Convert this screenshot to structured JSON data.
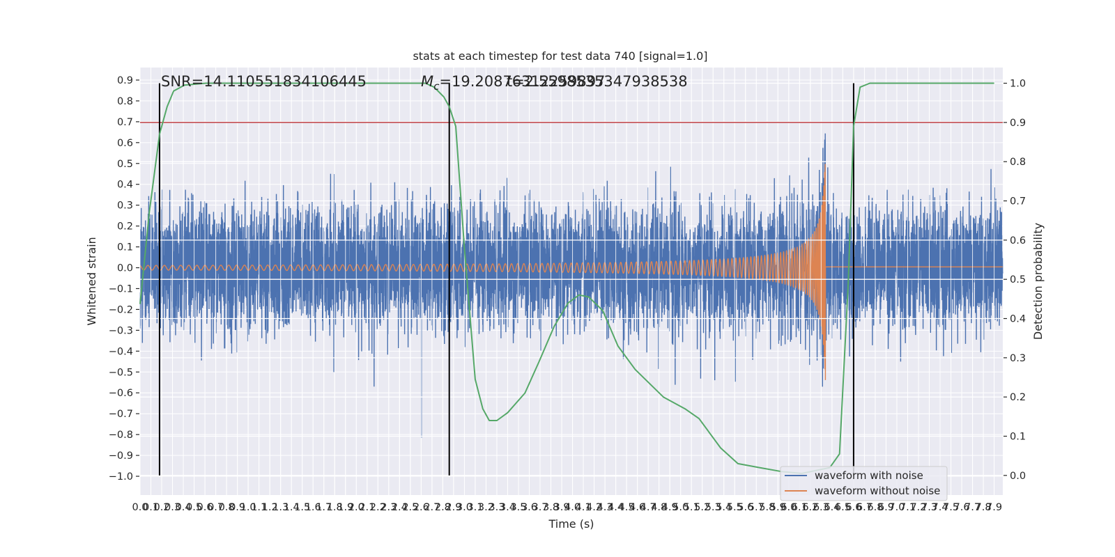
{
  "chart_data": {
    "type": "line",
    "title": "stats at each timestep for test data 740 [signal=1.0]",
    "xlabel": "Time (s)",
    "ylabel": "Whitened strain",
    "ylabel_right": "Detection probability",
    "xlim": [
      0.0,
      7.98
    ],
    "ylim": [
      -1.09,
      0.96
    ],
    "ylim_right": [
      -0.05,
      1.04
    ],
    "xticks": [
      "0.0",
      "0.1",
      "0.2",
      "0.3",
      "0.4",
      "0.5",
      "0.6",
      "0.7",
      "0.8",
      "0.9",
      "1.0",
      "1.1",
      "1.2",
      "1.3",
      "1.4",
      "1.5",
      "1.6",
      "1.7",
      "1.8",
      "1.9",
      "2.0",
      "2.1",
      "2.2",
      "2.3",
      "2.4",
      "2.5",
      "2.6",
      "2.7",
      "2.8",
      "2.9",
      "3.0",
      "3.1",
      "3.2",
      "3.3",
      "3.4",
      "3.5",
      "3.6",
      "3.7",
      "3.8",
      "3.9",
      "4.0",
      "4.1",
      "4.2",
      "4.3",
      "4.4",
      "4.5",
      "4.6",
      "4.7",
      "4.8",
      "4.9",
      "5.0",
      "5.1",
      "5.2",
      "5.3",
      "5.4",
      "5.5",
      "5.6",
      "5.7",
      "5.8",
      "5.9",
      "6.0",
      "6.1",
      "6.2",
      "6.3",
      "6.4",
      "6.5",
      "6.6",
      "6.7",
      "6.8",
      "6.9",
      "7.0",
      "7.1",
      "7.2",
      "7.3",
      "7.4",
      "7.5",
      "7.6",
      "7.7",
      "7.8",
      "7.9"
    ],
    "yticks_left": [
      "−1.0",
      "−0.9",
      "−0.8",
      "−0.7",
      "−0.6",
      "−0.5",
      "−0.4",
      "−0.3",
      "−0.2",
      "−0.1",
      "0.0",
      "0.1",
      "0.2",
      "0.3",
      "0.4",
      "0.5",
      "0.6",
      "0.7",
      "0.8",
      "0.9"
    ],
    "yticks_right": [
      "0.0",
      "0.1",
      "0.2",
      "0.3",
      "0.4",
      "0.5",
      "0.6",
      "0.7",
      "0.8",
      "0.9",
      "1.0"
    ],
    "grid": true,
    "legend": {
      "placement": "lower-right",
      "entries": [
        "waveform with noise",
        "waveform without noise"
      ]
    },
    "annotations": {
      "snr": "SNR=14.110551834106445",
      "mc_label": "M",
      "mc_sub": "c",
      "mc_value": "=19.20876312259897",
      "overlap_text": "t=2.5598535347938538"
    },
    "series": [
      {
        "name": "waveform with noise",
        "axis": "left",
        "color": "#4c72b0",
        "description_kind": "noisy strain"
      },
      {
        "name": "waveform without noise",
        "axis": "left",
        "color": "#dd8452",
        "description_kind": "chirp"
      },
      {
        "axis": "right",
        "color": "#55a868",
        "x": [
          0,
          0.085,
          0.18,
          0.25,
          0.31,
          0.41,
          0.61,
          2.64,
          2.72,
          2.81,
          2.86,
          2.92,
          3.0,
          3.1,
          3.17,
          3.23,
          3.3,
          3.4,
          3.56,
          3.69,
          3.83,
          3.96,
          4.06,
          4.15,
          4.28,
          4.42,
          4.58,
          4.84,
          5.04,
          5.17,
          5.37,
          5.53,
          5.73,
          5.93,
          6.12,
          6.38,
          6.47,
          6.55,
          6.6,
          6.66,
          6.75,
          7.9
        ],
        "y": [
          0.437,
          0.67,
          0.87,
          0.94,
          0.98,
          0.995,
          1.0,
          1.0,
          0.99,
          0.965,
          0.94,
          0.89,
          0.58,
          0.245,
          0.17,
          0.14,
          0.14,
          0.16,
          0.21,
          0.29,
          0.38,
          0.44,
          0.46,
          0.455,
          0.42,
          0.33,
          0.27,
          0.2,
          0.17,
          0.145,
          0.07,
          0.03,
          0.02,
          0.01,
          0.005,
          0.02,
          0.055,
          0.49,
          0.89,
          0.99,
          1.0,
          1.0
        ]
      }
    ],
    "vlines": {
      "x": [
        0.18,
        2.86,
        6.6
      ],
      "ymin": 0.0,
      "ymax": 1.0,
      "axis": "right",
      "color": "#000000"
    },
    "hline": {
      "y": 0.9,
      "axis": "right",
      "color": "#c44e52"
    }
  }
}
